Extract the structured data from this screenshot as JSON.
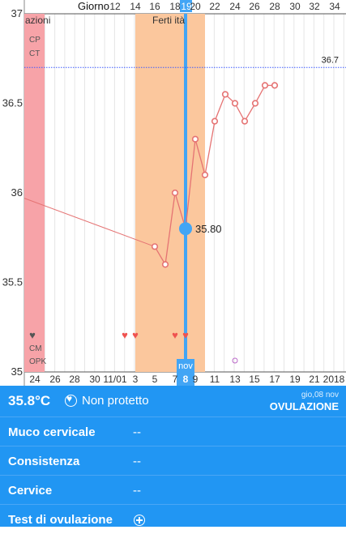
{
  "chart_data": {
    "type": "line",
    "y_ticks": [
      "37",
      "36.5",
      "36",
      "35.5",
      "35"
    ],
    "ylim": [
      35,
      37
    ],
    "top_axis_title": "Giorno",
    "top_ticks": [
      "12",
      "14",
      "16",
      "18",
      "19",
      "20",
      "22",
      "24",
      "26",
      "28",
      "30",
      "32",
      "34"
    ],
    "bottom_ticks": [
      "24",
      "26",
      "28",
      "30",
      "11/01",
      "3",
      "5",
      "7",
      "8",
      "9",
      "11",
      "13",
      "15",
      "17",
      "19",
      "21",
      "2018"
    ],
    "bottom_month_label": "nov",
    "period_label": "azioni",
    "fertile_label": "Ferti ità",
    "left_markers": [
      "CP",
      "CT",
      "CM",
      "OPK"
    ],
    "coverline_value": 36.7,
    "coverline_label": "36.7",
    "selected": {
      "label": "35.80",
      "value": 35.8
    },
    "temperatures": [
      {
        "x": 3,
        "y": 35.7
      },
      {
        "x": 4,
        "y": 35.6
      },
      {
        "x": 5,
        "y": 36.0
      },
      {
        "x": 6,
        "y": 35.8
      },
      {
        "x": 7,
        "y": 36.3
      },
      {
        "x": 8,
        "y": 36.1
      },
      {
        "x": 9,
        "y": 36.4
      },
      {
        "x": 10,
        "y": 36.55
      },
      {
        "x": 11,
        "y": 36.5
      },
      {
        "x": 12,
        "y": 36.4
      },
      {
        "x": 13,
        "y": 36.5
      },
      {
        "x": 14,
        "y": 36.6
      },
      {
        "x": 15,
        "y": 36.6
      }
    ],
    "colors": {
      "period": "#f7a3a8",
      "fertile": "#fbc79d",
      "line": "#e57373",
      "selected": "#42a5f5",
      "coverline": "#3d5afe",
      "grid": "#e6e6e6"
    }
  },
  "status": {
    "temperature": "35.8°C",
    "protection": "Non protetto",
    "date": "gio,08 nov",
    "event": "OVULAZIONE"
  },
  "details": [
    {
      "label": "Muco cervicale",
      "value": "--"
    },
    {
      "label": "Consistenza",
      "value": "--"
    },
    {
      "label": "Cervice",
      "value": "--"
    },
    {
      "label": "Test di ovulazione",
      "value": ""
    }
  ]
}
